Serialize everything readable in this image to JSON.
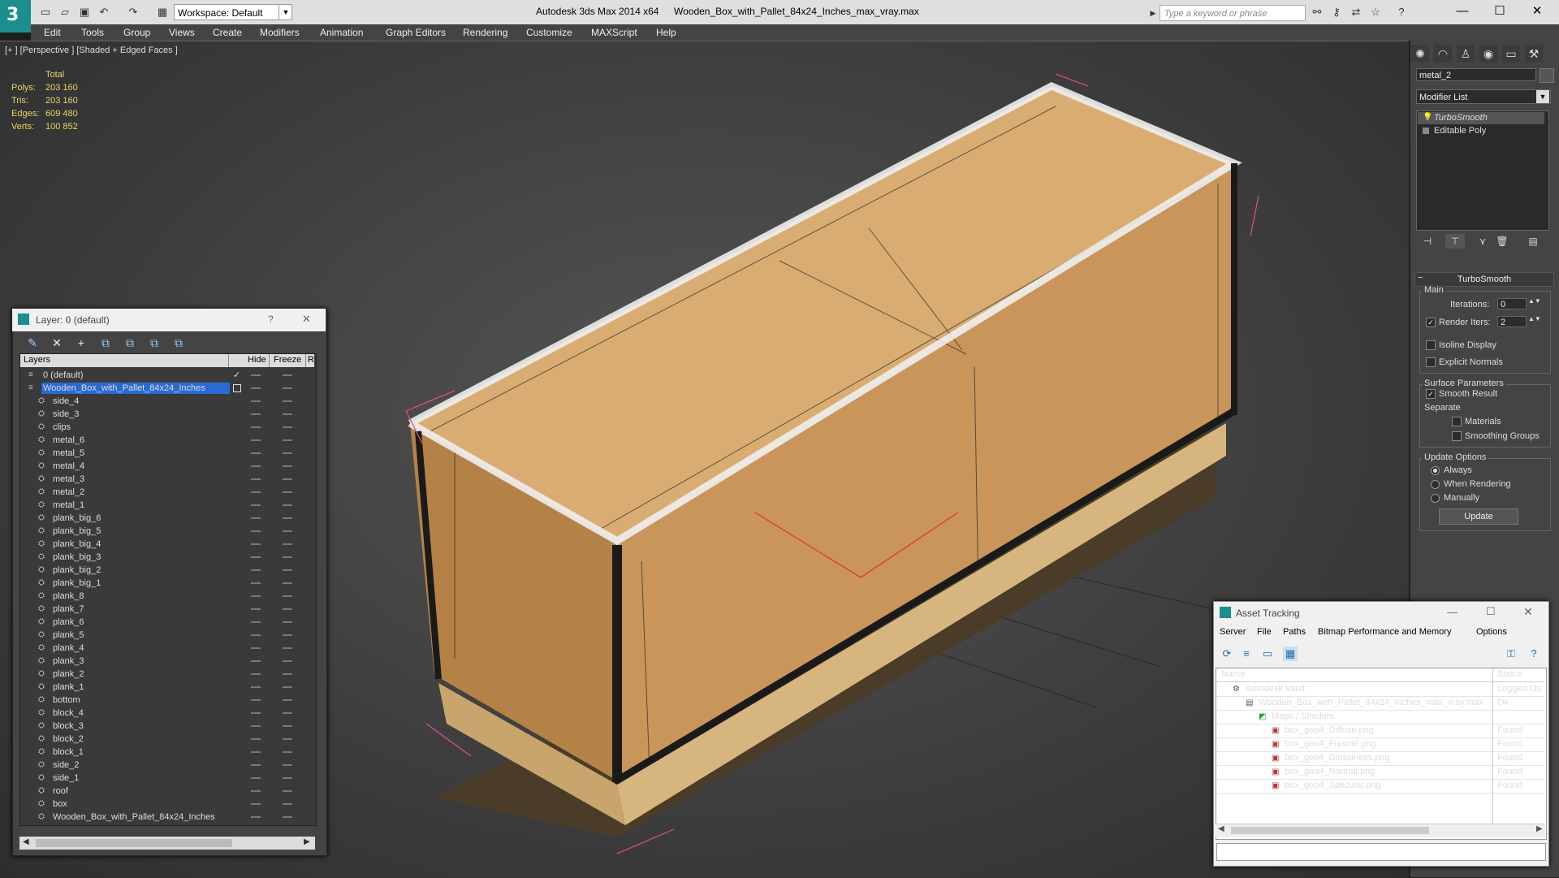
{
  "app": {
    "title": "Autodesk 3ds Max  2014 x64",
    "file": "Wooden_Box_with_Pallet_84x24_Inches_max_vray.max",
    "workspace": "Workspace: Default",
    "search_placeholder": "Type a keyword or phrase"
  },
  "menu": [
    "Edit",
    "Tools",
    "Group",
    "Views",
    "Create",
    "Modifiers",
    "Animation",
    "Graph Editors",
    "Rendering",
    "Customize",
    "MAXScript",
    "Help"
  ],
  "viewport": {
    "label": "[+ ] [Perspective ] [Shaded + Edged Faces ]",
    "stats": {
      "header": "Total",
      "rows": [
        {
          "label": "Polys:",
          "value": "203 160"
        },
        {
          "label": "Tris:",
          "value": "203 160"
        },
        {
          "label": "Edges:",
          "value": "609 480"
        },
        {
          "label": "Verts:",
          "value": "100 852"
        }
      ]
    }
  },
  "command_panel": {
    "object_name": "metal_2",
    "modifier_list": "Modifier List",
    "stack": [
      "TurboSmooth",
      "Editable Poly"
    ],
    "rollout": "TurboSmooth",
    "main_group": "Main",
    "iterations_label": "Iterations:",
    "iterations_value": "0",
    "render_iters_label": "Render Iters:",
    "render_iters_value": "2",
    "isoline": "Isoline Display",
    "explicit_normals": "Explicit Normals",
    "surface_group": "Surface Parameters",
    "smooth_result": "Smooth Result",
    "separate": "Separate",
    "materials": "Materials",
    "smoothing_groups": "Smoothing Groups",
    "update_group": "Update Options",
    "always": "Always",
    "when_rendering": "When Rendering",
    "manually": "Manually",
    "update_button": "Update"
  },
  "layer_dialog": {
    "title": "Layer: 0 (default)",
    "help": "?",
    "close": "✕",
    "columns": {
      "layers": "Layers",
      "hide": "Hide",
      "freeze": "Freeze",
      "render": "R"
    },
    "rows": [
      {
        "name": "0 (default)",
        "level": 1,
        "checked": true
      },
      {
        "name": "Wooden_Box_with_Pallet_84x24_Inches",
        "level": 1,
        "selected": true
      },
      {
        "name": "side_4",
        "level": 2
      },
      {
        "name": "side_3",
        "level": 2
      },
      {
        "name": "clips",
        "level": 2
      },
      {
        "name": "metal_6",
        "level": 2
      },
      {
        "name": "metal_5",
        "level": 2
      },
      {
        "name": "metal_4",
        "level": 2
      },
      {
        "name": "metal_3",
        "level": 2
      },
      {
        "name": "metal_2",
        "level": 2
      },
      {
        "name": "metal_1",
        "level": 2
      },
      {
        "name": "plank_big_6",
        "level": 2
      },
      {
        "name": "plank_big_5",
        "level": 2
      },
      {
        "name": "plank_big_4",
        "level": 2
      },
      {
        "name": "plank_big_3",
        "level": 2
      },
      {
        "name": "plank_big_2",
        "level": 2
      },
      {
        "name": "plank_big_1",
        "level": 2
      },
      {
        "name": "plank_8",
        "level": 2
      },
      {
        "name": "plank_7",
        "level": 2
      },
      {
        "name": "plank_6",
        "level": 2
      },
      {
        "name": "plank_5",
        "level": 2
      },
      {
        "name": "plank_4",
        "level": 2
      },
      {
        "name": "plank_3",
        "level": 2
      },
      {
        "name": "plank_2",
        "level": 2
      },
      {
        "name": "plank_1",
        "level": 2
      },
      {
        "name": "bottom",
        "level": 2
      },
      {
        "name": "block_4",
        "level": 2
      },
      {
        "name": "block_3",
        "level": 2
      },
      {
        "name": "block_2",
        "level": 2
      },
      {
        "name": "block_1",
        "level": 2
      },
      {
        "name": "side_2",
        "level": 2
      },
      {
        "name": "side_1",
        "level": 2
      },
      {
        "name": "roof",
        "level": 2
      },
      {
        "name": "box",
        "level": 2
      },
      {
        "name": "Wooden_Box_with_Pallet_84x24_Inches",
        "level": 2
      }
    ]
  },
  "asset_dialog": {
    "title": "Asset Tracking",
    "menu": [
      "Server",
      "File",
      "Paths",
      "Bitmap Performance and Memory",
      "Options"
    ],
    "columns": {
      "name": "Name",
      "status": "Status"
    },
    "rows": [
      {
        "name": "Autodesk Vault",
        "status": "Logged Ou",
        "indent": 0
      },
      {
        "name": "Wooden_Box_with_Pallet_84x24_Inches_max_vray.max",
        "status": "Ok",
        "indent": 1
      },
      {
        "name": "Maps / Shaders",
        "status": "",
        "indent": 2
      },
      {
        "name": "box_geo4_Diffuse.png",
        "status": "Found",
        "indent": 3
      },
      {
        "name": "box_geo4_Fresnel.png",
        "status": "Found",
        "indent": 3
      },
      {
        "name": "box_geo4_Glossiness.png",
        "status": "Found",
        "indent": 3
      },
      {
        "name": "box_geo4_Normal.png",
        "status": "Found",
        "indent": 3
      },
      {
        "name": "box_geo4_Specular.png",
        "status": "Found",
        "indent": 3
      }
    ]
  },
  "colors": {
    "accent": "#1b8e8e",
    "selection": "#2a6ad6",
    "stats": "#e8d26c",
    "wood": "#d6a86a"
  }
}
